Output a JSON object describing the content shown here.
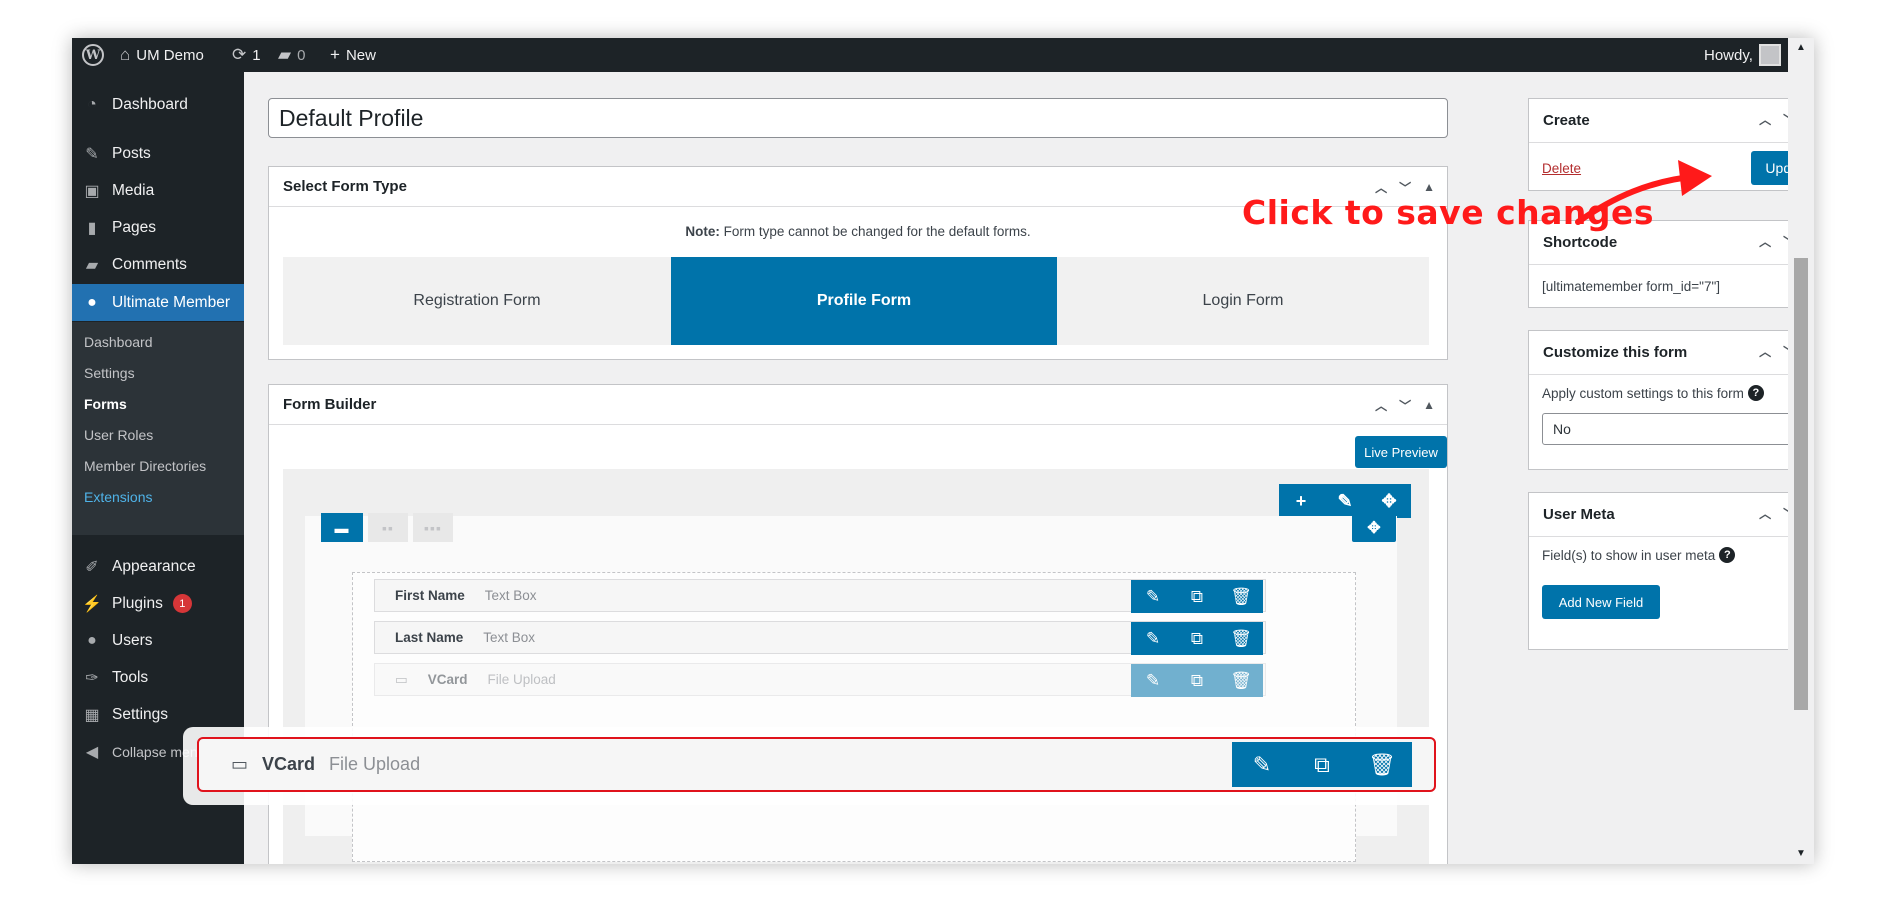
{
  "admin_bar": {
    "site_name": "UM Demo",
    "updates_count": "1",
    "comments_count": "0",
    "new_label": "New",
    "howdy": "Howdy,"
  },
  "sidebar": {
    "dashboard": "Dashboard",
    "posts": "Posts",
    "media": "Media",
    "pages": "Pages",
    "comments": "Comments",
    "ultimate_member": "Ultimate Member",
    "submenu": [
      "Dashboard",
      "Settings",
      "Forms",
      "User Roles",
      "Member Directories",
      "Extensions"
    ],
    "appearance": "Appearance",
    "plugins": "Plugins",
    "plugins_badge": "1",
    "users": "Users",
    "tools": "Tools",
    "settings": "Settings",
    "collapse": "Collapse menu"
  },
  "form_title": "Default Profile",
  "select_form_type": {
    "heading": "Select Form Type",
    "note_bold": "Note:",
    "note_text": " Form type cannot be changed for the default forms.",
    "tabs": [
      "Registration Form",
      "Profile Form",
      "Login Form"
    ],
    "active_tab": "Profile Form"
  },
  "form_builder": {
    "heading": "Form Builder",
    "live_preview": "Live Preview",
    "fields": [
      {
        "name": "First Name",
        "type": "Text Box"
      },
      {
        "name": "Last Name",
        "type": "Text Box"
      },
      {
        "name": "VCard",
        "type": "File Upload"
      }
    ],
    "dragged_field": {
      "name": "VCard",
      "type": "File Upload"
    }
  },
  "create_box": {
    "heading": "Create",
    "delete_label": "Delete",
    "update_label": "Update"
  },
  "shortcode_box": {
    "heading": "Shortcode",
    "shortcode": "[ultimatemember form_id=\"7\"]"
  },
  "customize_box": {
    "heading": "Customize this form",
    "label": "Apply custom settings to this form",
    "selected": "No"
  },
  "user_meta_box": {
    "heading": "User Meta",
    "label": "Field(s) to show in user meta",
    "add_button": "Add New Field"
  },
  "annotation": {
    "text": "Click to save changes",
    "color": "#ff1a1a"
  },
  "colors": {
    "wp_dark": "#1d2327",
    "wp_blue": "#2271b1",
    "um_blue": "#0073aa",
    "highlight_red": "#e0131c"
  }
}
